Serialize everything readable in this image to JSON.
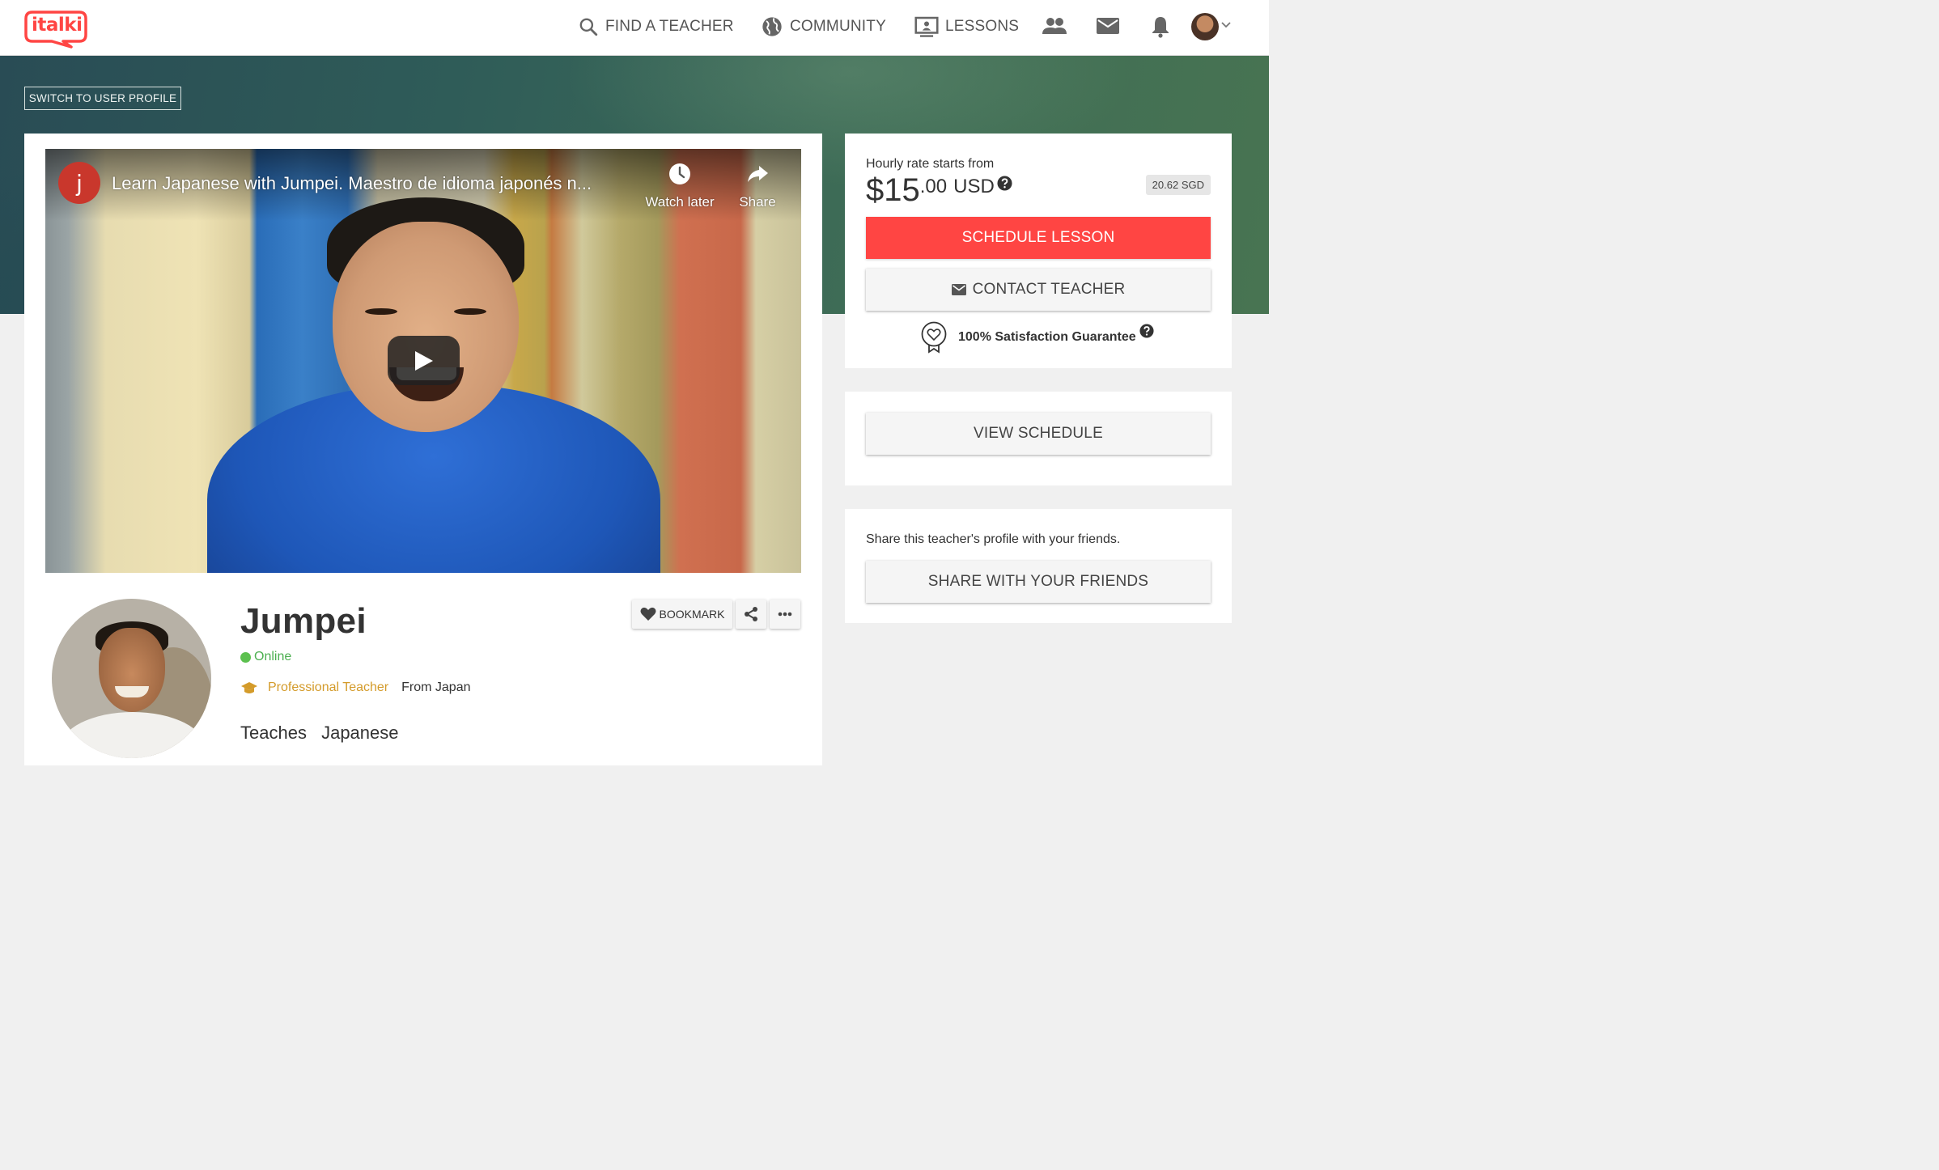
{
  "nav": {
    "logo_text": "italki",
    "find_teacher": "FIND A TEACHER",
    "community": "COMMUNITY",
    "lessons": "LESSONS",
    "icons": [
      "people-icon",
      "mail-icon",
      "bell-icon"
    ]
  },
  "hero": {
    "switch_label": "SWITCH TO USER PROFILE"
  },
  "video": {
    "channel_initial": "j",
    "title": "Learn Japanese with Jumpei. Maestro de idioma japonés n...",
    "watch_later": "Watch later",
    "share": "Share"
  },
  "profile": {
    "name": "Jumpei",
    "status": "Online",
    "teacher_type": "Professional Teacher",
    "from": "From Japan",
    "teaches_label": "Teaches",
    "teaches_language": "Japanese",
    "bookmark_label": "BOOKMARK"
  },
  "pricing": {
    "rate_label": "Hourly rate starts from",
    "price_whole": "$15",
    "price_cents": ".00",
    "currency": "USD",
    "converted": "20.62 SGD",
    "schedule_label": "SCHEDULE LESSON",
    "contact_label": "CONTACT TEACHER",
    "guarantee": "100% Satisfaction Guarantee"
  },
  "schedule_card": {
    "view_schedule": "VIEW SCHEDULE"
  },
  "share_card": {
    "text": "Share this teacher's profile with your friends.",
    "button": "SHARE WITH YOUR FRIENDS"
  },
  "colors": {
    "brand_red": "#ff4543",
    "online_green": "#5cc04f",
    "pro_gold": "#d49b2a"
  }
}
